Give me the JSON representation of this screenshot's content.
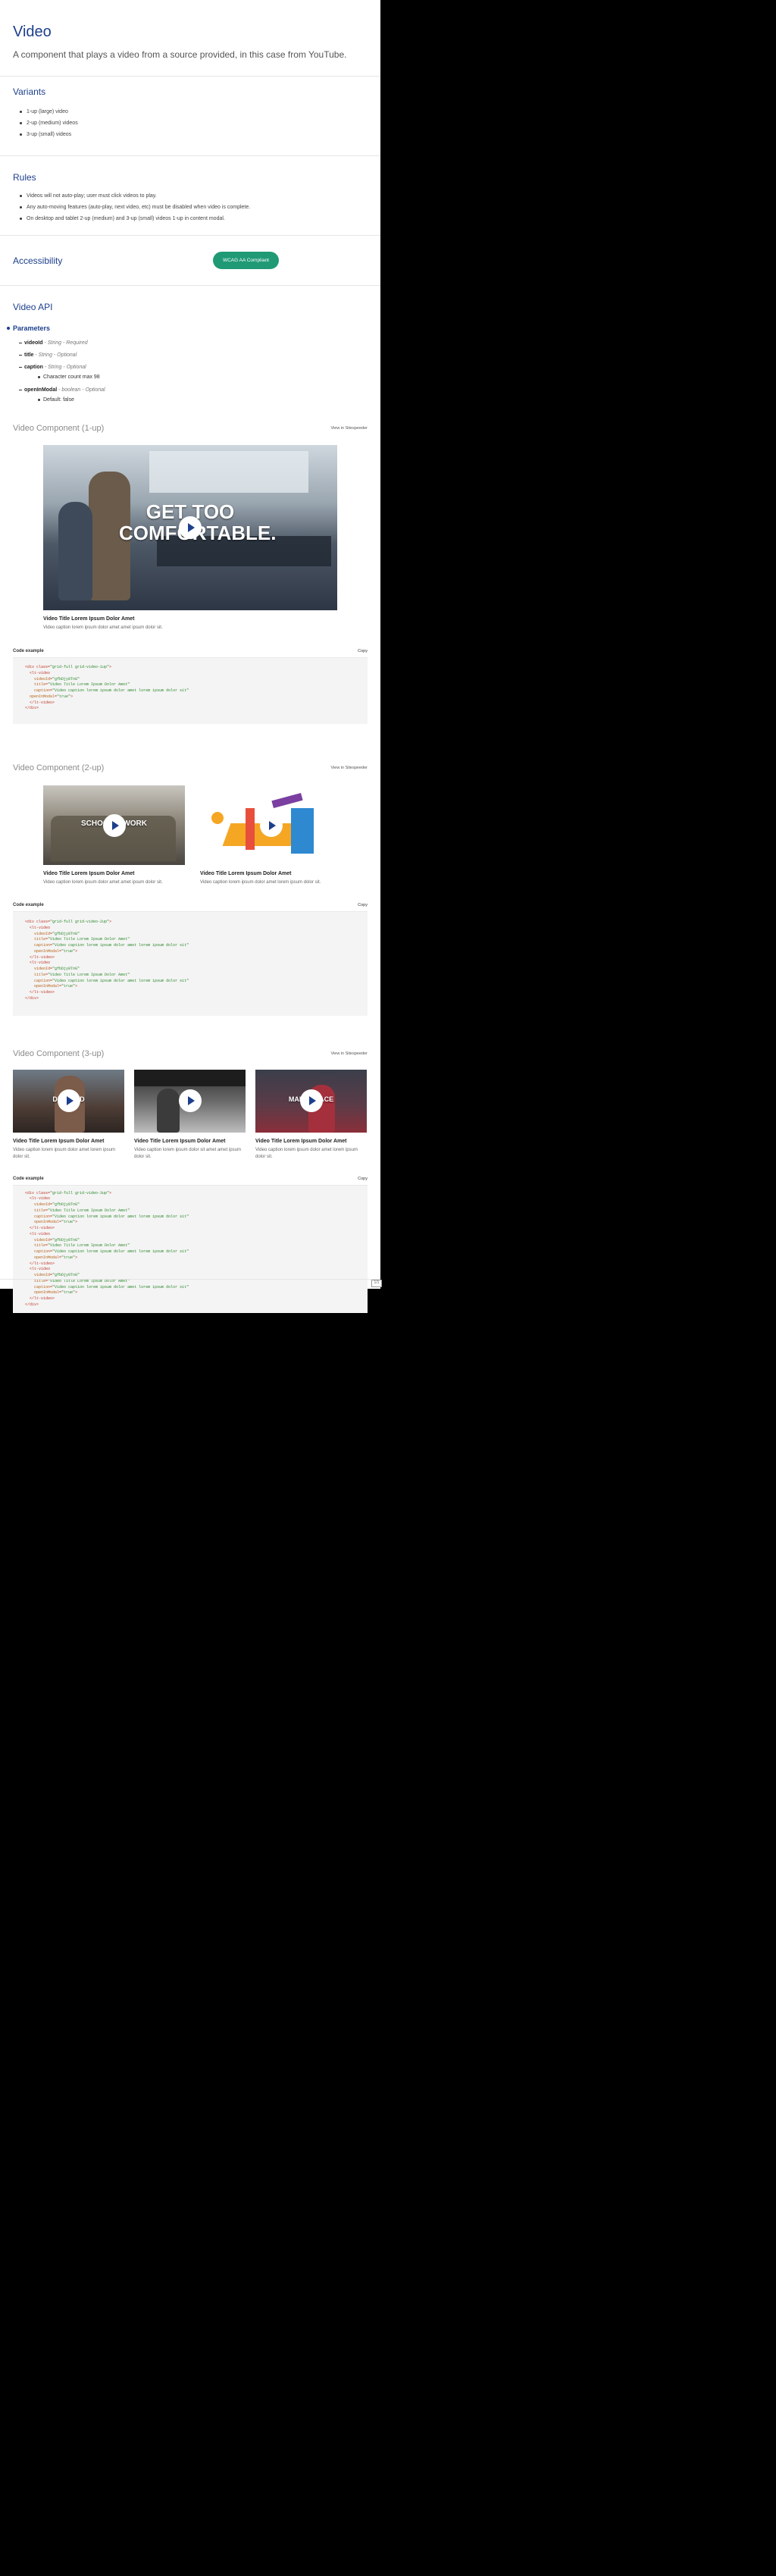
{
  "header": {
    "title": "Video",
    "subtitle": "A component that plays a video from a source provided, in this case from YouTube."
  },
  "variants": {
    "heading": "Variants",
    "items": [
      "1-up (large) video",
      "2-up (medium) videos",
      "3-up (small) videos"
    ]
  },
  "rules": {
    "heading": "Rules",
    "items": [
      "Videos will not auto-play; user must click videos to play.",
      "Any auto-moving features (auto-play, next video, etc) must be disabled when video is complete.",
      "On desktop and tablet 2-up (medium) and 3-up (small) videos 1-up in content modal."
    ]
  },
  "accessibility": {
    "heading": "Accessibility",
    "badge": "WCAG AA Compliant"
  },
  "api": {
    "heading": "Video API",
    "params_title": "Parameters",
    "params": [
      {
        "name": "videoId",
        "desc": " - String - Required"
      },
      {
        "name": "title",
        "desc": " - String - Optional"
      },
      {
        "name": "caption",
        "desc": " - String - Optional"
      },
      {
        "name": "openInModal",
        "desc": " - boolean - Optional"
      }
    ],
    "caption_note": "Character count max 98",
    "modal_note": "Default: false"
  },
  "one_up": {
    "heading": "Video Component (1-up)",
    "link": "View in Sitespeeder",
    "overlay": "GET TOO COMFORTABLE.",
    "title": "Video Title Lorem Ipsum Dolor Amet",
    "caption": "Video caption lorem ipsum dolor amet amet ipsum dolor sit."
  },
  "two_up": {
    "heading": "Video Component (2-up)",
    "link": "View in Sitespeeder",
    "overlay": "SCHOOL & WORK",
    "videos": [
      {
        "title": "Video Title Lorem Ipsum Dolor Amet",
        "caption": "Video caption lorem ipsum dolor amet amet ipsum dolor sit."
      },
      {
        "title": "Video Title Lorem Ipsum Dolor Amet",
        "caption": "Video caption lorem ipsum dolor amet lorem ipsum dolor sit."
      }
    ]
  },
  "three_up": {
    "heading": "Video Component (3-up)",
    "link": "View in Sitespeeder",
    "overlays": [
      "DELAYED",
      "",
      "MAKE SPACE"
    ],
    "videos": [
      {
        "title": "Video Title Lorem Ipsum Dolor Amet",
        "caption": "Video caption lorem ipsum dolor amet lorem ipsum dolor sit."
      },
      {
        "title": "Video Title Lorem Ipsum Dolor Amet",
        "caption": "Video caption lorem ipsum dolor sit amet amet ipsum dolor sit."
      },
      {
        "title": "Video Title Lorem Ipsum Dolor Amet",
        "caption": "Video caption lorem ipsum dolor amet lorem ipsum dolor sit."
      }
    ]
  },
  "code": {
    "label": "Code example",
    "copy": "Copy"
  },
  "code_one": [
    [
      [
        "t",
        "<div class="
      ],
      [
        "s",
        "\"grid-full grid-video-1up\""
      ],
      [
        "t",
        ">"
      ]
    ],
    [
      [
        "t",
        "  <lt-video"
      ]
    ],
    [
      [
        "t",
        "    "
      ],
      [
        "a",
        "videoId"
      ],
      [
        "t",
        "="
      ],
      [
        "s",
        "\"gfbDjy8TnG\""
      ]
    ],
    [
      [
        "t",
        "    "
      ],
      [
        "a",
        "title"
      ],
      [
        "t",
        "="
      ],
      [
        "s",
        "\"Video Title Lorem Ipsum Dolor Amet\""
      ]
    ],
    [
      [
        "t",
        "    "
      ],
      [
        "a",
        "caption"
      ],
      [
        "t",
        "="
      ],
      [
        "s",
        "\"Video caption lorem ipsum dolor amet lorem ipsum dolor sit\""
      ]
    ],
    [
      [
        "t",
        "  "
      ],
      [
        "a",
        "openInModal"
      ],
      [
        "t",
        "="
      ],
      [
        "s",
        "\"true\""
      ],
      [
        "t",
        ">"
      ]
    ],
    [
      [
        "t",
        "  </lt-video>"
      ]
    ],
    [
      [
        "t",
        "</div>"
      ]
    ]
  ],
  "code_two": [
    [
      [
        "t",
        "<div class="
      ],
      [
        "s",
        "\"grid-full grid-video-2up\""
      ],
      [
        "t",
        ">"
      ]
    ],
    [
      [
        "t",
        "  <lt-video"
      ]
    ],
    [
      [
        "t",
        "    "
      ],
      [
        "a",
        "videoId"
      ],
      [
        "t",
        "="
      ],
      [
        "s",
        "\"gfbDjy8TnG\""
      ]
    ],
    [
      [
        "t",
        "    "
      ],
      [
        "a",
        "title"
      ],
      [
        "t",
        "="
      ],
      [
        "s",
        "\"Video Title Lorem Ipsum Dolor Amet\""
      ]
    ],
    [
      [
        "t",
        "    "
      ],
      [
        "a",
        "caption"
      ],
      [
        "t",
        "="
      ],
      [
        "s",
        "\"Video caption lorem ipsum dolor amet lorem ipsum dolor sit\""
      ]
    ],
    [
      [
        "t",
        "    "
      ],
      [
        "a",
        "openInModal"
      ],
      [
        "t",
        "="
      ],
      [
        "s",
        "\"true\""
      ],
      [
        "t",
        ">"
      ]
    ],
    [
      [
        "t",
        "  </lt-video>"
      ]
    ],
    [
      [
        "t",
        "  <lt-video"
      ]
    ],
    [
      [
        "t",
        "    "
      ],
      [
        "a",
        "videoId"
      ],
      [
        "t",
        "="
      ],
      [
        "s",
        "\"gfbDjy8TnG\""
      ]
    ],
    [
      [
        "t",
        "    "
      ],
      [
        "a",
        "title"
      ],
      [
        "t",
        "="
      ],
      [
        "s",
        "\"Video Title Lorem Ipsum Dolor Amet\""
      ]
    ],
    [
      [
        "t",
        "    "
      ],
      [
        "a",
        "caption"
      ],
      [
        "t",
        "="
      ],
      [
        "s",
        "\"Video caption lorem ipsum dolor amet lorem ipsum dolor sit\""
      ]
    ],
    [
      [
        "t",
        "    "
      ],
      [
        "a",
        "openInModal"
      ],
      [
        "t",
        "="
      ],
      [
        "s",
        "\"true\""
      ],
      [
        "t",
        ">"
      ]
    ],
    [
      [
        "t",
        "  </lt-video>"
      ]
    ],
    [
      [
        "t",
        "</div>"
      ]
    ]
  ],
  "code_three": [
    [
      [
        "t",
        "<div class="
      ],
      [
        "s",
        "\"grid-full grid-video-3up\""
      ],
      [
        "t",
        ">"
      ]
    ],
    [
      [
        "t",
        "  <lt-video"
      ]
    ],
    [
      [
        "t",
        "    "
      ],
      [
        "a",
        "videoId"
      ],
      [
        "t",
        "="
      ],
      [
        "s",
        "\"gfbDjy8TnG\""
      ]
    ],
    [
      [
        "t",
        "    "
      ],
      [
        "a",
        "title"
      ],
      [
        "t",
        "="
      ],
      [
        "s",
        "\"Video Title Lorem Ipsum Dolor Amet\""
      ]
    ],
    [
      [
        "t",
        "    "
      ],
      [
        "a",
        "caption"
      ],
      [
        "t",
        "="
      ],
      [
        "s",
        "\"Video caption lorem ipsum dolor amet lorem ipsum dolor sit\""
      ]
    ],
    [
      [
        "t",
        "    "
      ],
      [
        "a",
        "openInModal"
      ],
      [
        "t",
        "="
      ],
      [
        "s",
        "\"true\""
      ],
      [
        "t",
        ">"
      ]
    ],
    [
      [
        "t",
        "  </lt-video>"
      ]
    ],
    [
      [
        "t",
        "  <lt-video"
      ]
    ],
    [
      [
        "t",
        "    "
      ],
      [
        "a",
        "videoId"
      ],
      [
        "t",
        "="
      ],
      [
        "s",
        "\"gfbDjy8TnG\""
      ]
    ],
    [
      [
        "t",
        "    "
      ],
      [
        "a",
        "title"
      ],
      [
        "t",
        "="
      ],
      [
        "s",
        "\"Video Title Lorem Ipsum Dolor Amet\""
      ]
    ],
    [
      [
        "t",
        "    "
      ],
      [
        "a",
        "caption"
      ],
      [
        "t",
        "="
      ],
      [
        "s",
        "\"Video caption lorem ipsum dolor amet lorem ipsum dolor sit\""
      ]
    ],
    [
      [
        "t",
        "    "
      ],
      [
        "a",
        "openInModal"
      ],
      [
        "t",
        "="
      ],
      [
        "s",
        "\"true\""
      ],
      [
        "t",
        ">"
      ]
    ],
    [
      [
        "t",
        "  </lt-video>"
      ]
    ],
    [
      [
        "t",
        "  <lt-video"
      ]
    ],
    [
      [
        "t",
        "    "
      ],
      [
        "a",
        "videoId"
      ],
      [
        "t",
        "="
      ],
      [
        "s",
        "\"gfbDjy8TnG\""
      ]
    ],
    [
      [
        "t",
        "    "
      ],
      [
        "a",
        "title"
      ],
      [
        "t",
        "="
      ],
      [
        "s",
        "\"Video Title Lorem Ipsum Dolor Amet\""
      ]
    ],
    [
      [
        "t",
        "    "
      ],
      [
        "a",
        "caption"
      ],
      [
        "t",
        "="
      ],
      [
        "s",
        "\"Video caption lorem ipsum dolor amet lorem ipsum dolor sit\""
      ]
    ],
    [
      [
        "t",
        "    "
      ],
      [
        "a",
        "openInModal"
      ],
      [
        "t",
        "="
      ],
      [
        "s",
        "\"true\""
      ],
      [
        "t",
        ">"
      ]
    ],
    [
      [
        "t",
        "  </lt-video>"
      ]
    ],
    [
      [
        "t",
        "</div>"
      ]
    ]
  ],
  "corner_badge": "1/1"
}
